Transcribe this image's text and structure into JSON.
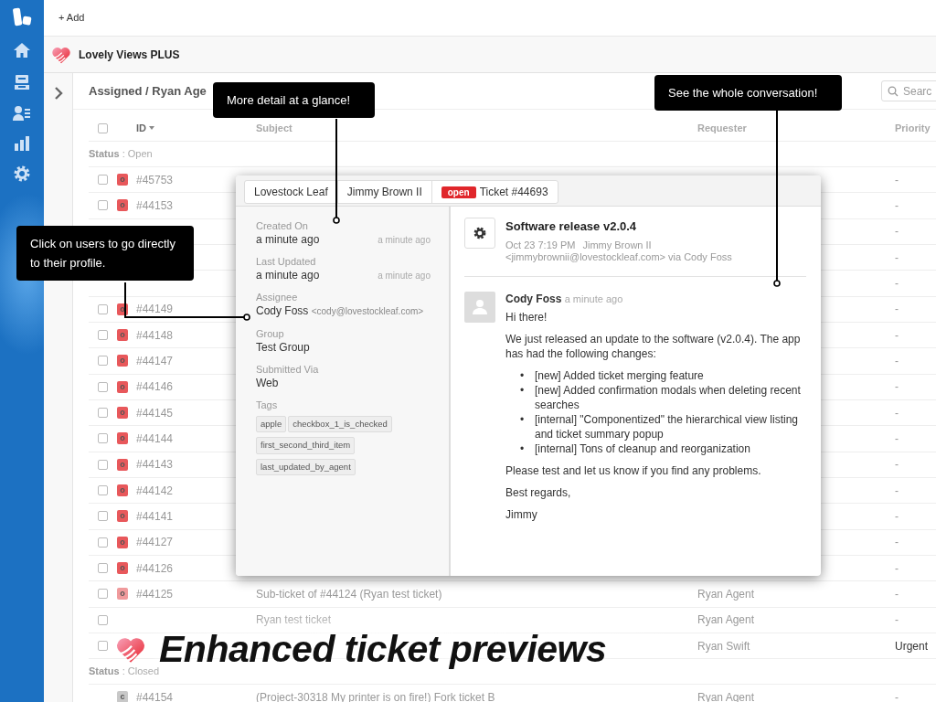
{
  "top_bar": {
    "add_button": "+ Add"
  },
  "view_header": {
    "title": "Lovely Views PLUS"
  },
  "list": {
    "breadcrumb": "Assigned / Ryan Age",
    "search": {
      "placeholder": "Searc"
    },
    "header_checkbox": {
      "checked": false
    },
    "columns": [
      {
        "label": "ID",
        "sorted": true
      },
      {
        "label": "Subject",
        "sorted": false
      },
      {
        "label": "Requester",
        "sorted": false
      },
      {
        "label": "Priority",
        "sorted": false
      }
    ],
    "groups": [
      {
        "label": "**Status** : Open",
        "rows": [
          {
            "checked": false,
            "color": "#e8585b",
            "badge": "o",
            "id": "#45753",
            "priority": "-"
          },
          {
            "checked": false,
            "color": "#e8585b",
            "badge": "o",
            "id": "#44153",
            "priority": "-"
          },
          {
            "priority": "-"
          },
          {
            "priority": "-"
          },
          {
            "priority": "-"
          },
          {
            "checked": false,
            "color": "#e8585b",
            "badge": "o",
            "id": "#44149",
            "priority": "-"
          },
          {
            "checked": false,
            "color": "#e8585b",
            "badge": "o",
            "id": "#44148",
            "priority": "-"
          },
          {
            "checked": false,
            "color": "#e8585b",
            "badge": "o",
            "id": "#44147",
            "priority": "-"
          },
          {
            "checked": false,
            "color": "#e8585b",
            "badge": "o",
            "id": "#44146",
            "priority": "-"
          },
          {
            "checked": false,
            "color": "#e8585b",
            "badge": "o",
            "id": "#44145",
            "priority": "-"
          },
          {
            "checked": false,
            "color": "#e8585b",
            "badge": "o",
            "id": "#44144",
            "priority": "-"
          },
          {
            "checked": false,
            "color": "#e8585b",
            "badge": "o",
            "id": "#44143",
            "priority": "-"
          },
          {
            "checked": false,
            "color": "#e8585b",
            "badge": "o",
            "id": "#44142",
            "priority": "-"
          },
          {
            "checked": false,
            "color": "#e8585b",
            "badge": "o",
            "id": "#44141",
            "priority": "-"
          },
          {
            "checked": false,
            "color": "#e8585b",
            "badge": "o",
            "id": "#44127",
            "priority": "-"
          },
          {
            "checked": false,
            "color": "#e8585b",
            "badge": "o",
            "id": "#44126",
            "priority": "-"
          },
          {
            "checked": false,
            "color": "#f09a9c",
            "badge": "o",
            "id": "#44125",
            "subject": "Sub-ticket of #44124 (Ryan test ticket)",
            "requester": "Ryan Agent",
            "priority": "-"
          },
          {
            "checked": false,
            "subject": "Ryan test ticket",
            "requester": "Ryan Agent",
            "priority": "-"
          },
          {
            "checked": false,
            "requester": "Ryan Swift",
            "priority": "Urgent"
          }
        ]
      },
      {
        "label": "**Status** : Closed",
        "rows": [
          {
            "color": "#c8c8c8",
            "badge": "c",
            "id": "#44154",
            "subject": "(Project-30318 My printer is on fire!) Fork ticket B",
            "requester": "Ryan Agent",
            "priority": "-"
          }
        ]
      }
    ]
  },
  "preview": {
    "tabs": [
      {
        "label": "Lovestock Leaf"
      },
      {
        "label": "Jimmy Brown II"
      },
      {
        "badge": "open",
        "label": "Ticket #44693"
      }
    ],
    "fields": [
      {
        "label": "Created On",
        "value": "a minute ago",
        "note": "a minute ago"
      },
      {
        "label": "Last Updated",
        "value": "a minute ago",
        "note": "a minute ago"
      },
      {
        "label": "Assignee",
        "value": "Cody Foss",
        "email": "<cody@lovestockleaf.com>"
      },
      {
        "label": "Group",
        "value": "Test Group"
      },
      {
        "label": "Submitted Via",
        "value": "Web"
      }
    ],
    "tags": {
      "label": "Tags",
      "items": [
        "apple",
        "checkbox_1_is_checked",
        "first_second_third_item",
        "last_updated_by_agent"
      ]
    },
    "message": {
      "subject": "Software release v2.0.4",
      "date": "Oct 23 7:19 PM",
      "sender": "Jimmy Brown II",
      "via": "<jimmybrownii@lovestockleaf.com> via Cody Foss"
    },
    "comment": {
      "author": "Cody Foss",
      "time": "a minute ago",
      "blocks": [
        {
          "kind": "paragraph",
          "text": "Hi there!"
        },
        {
          "kind": "paragraph",
          "text": "We just released an update to the software (v2.0.4). The app has had the following changes:"
        },
        {
          "kind": "list",
          "marker": "•",
          "items": [
            "[new] Added ticket merging feature",
            "[new] Added confirmation modals when deleting recent searches",
            "[internal] \"Componentized\" the hierarchical view listing and ticket summary popup",
            "[internal] Tons of cleanup and reorganization"
          ]
        },
        {
          "kind": "paragraph",
          "text": "Please test and let us know if you find any problems."
        },
        {
          "kind": "paragraph",
          "text": "Best regards,"
        },
        {
          "kind": "paragraph",
          "text": "Jimmy"
        }
      ]
    }
  },
  "callouts": [
    "More detail at a glance!",
    "See the whole conversation!",
    "Click on users to go directly to their profile."
  ],
  "headline": "Enhanced ticket previews"
}
